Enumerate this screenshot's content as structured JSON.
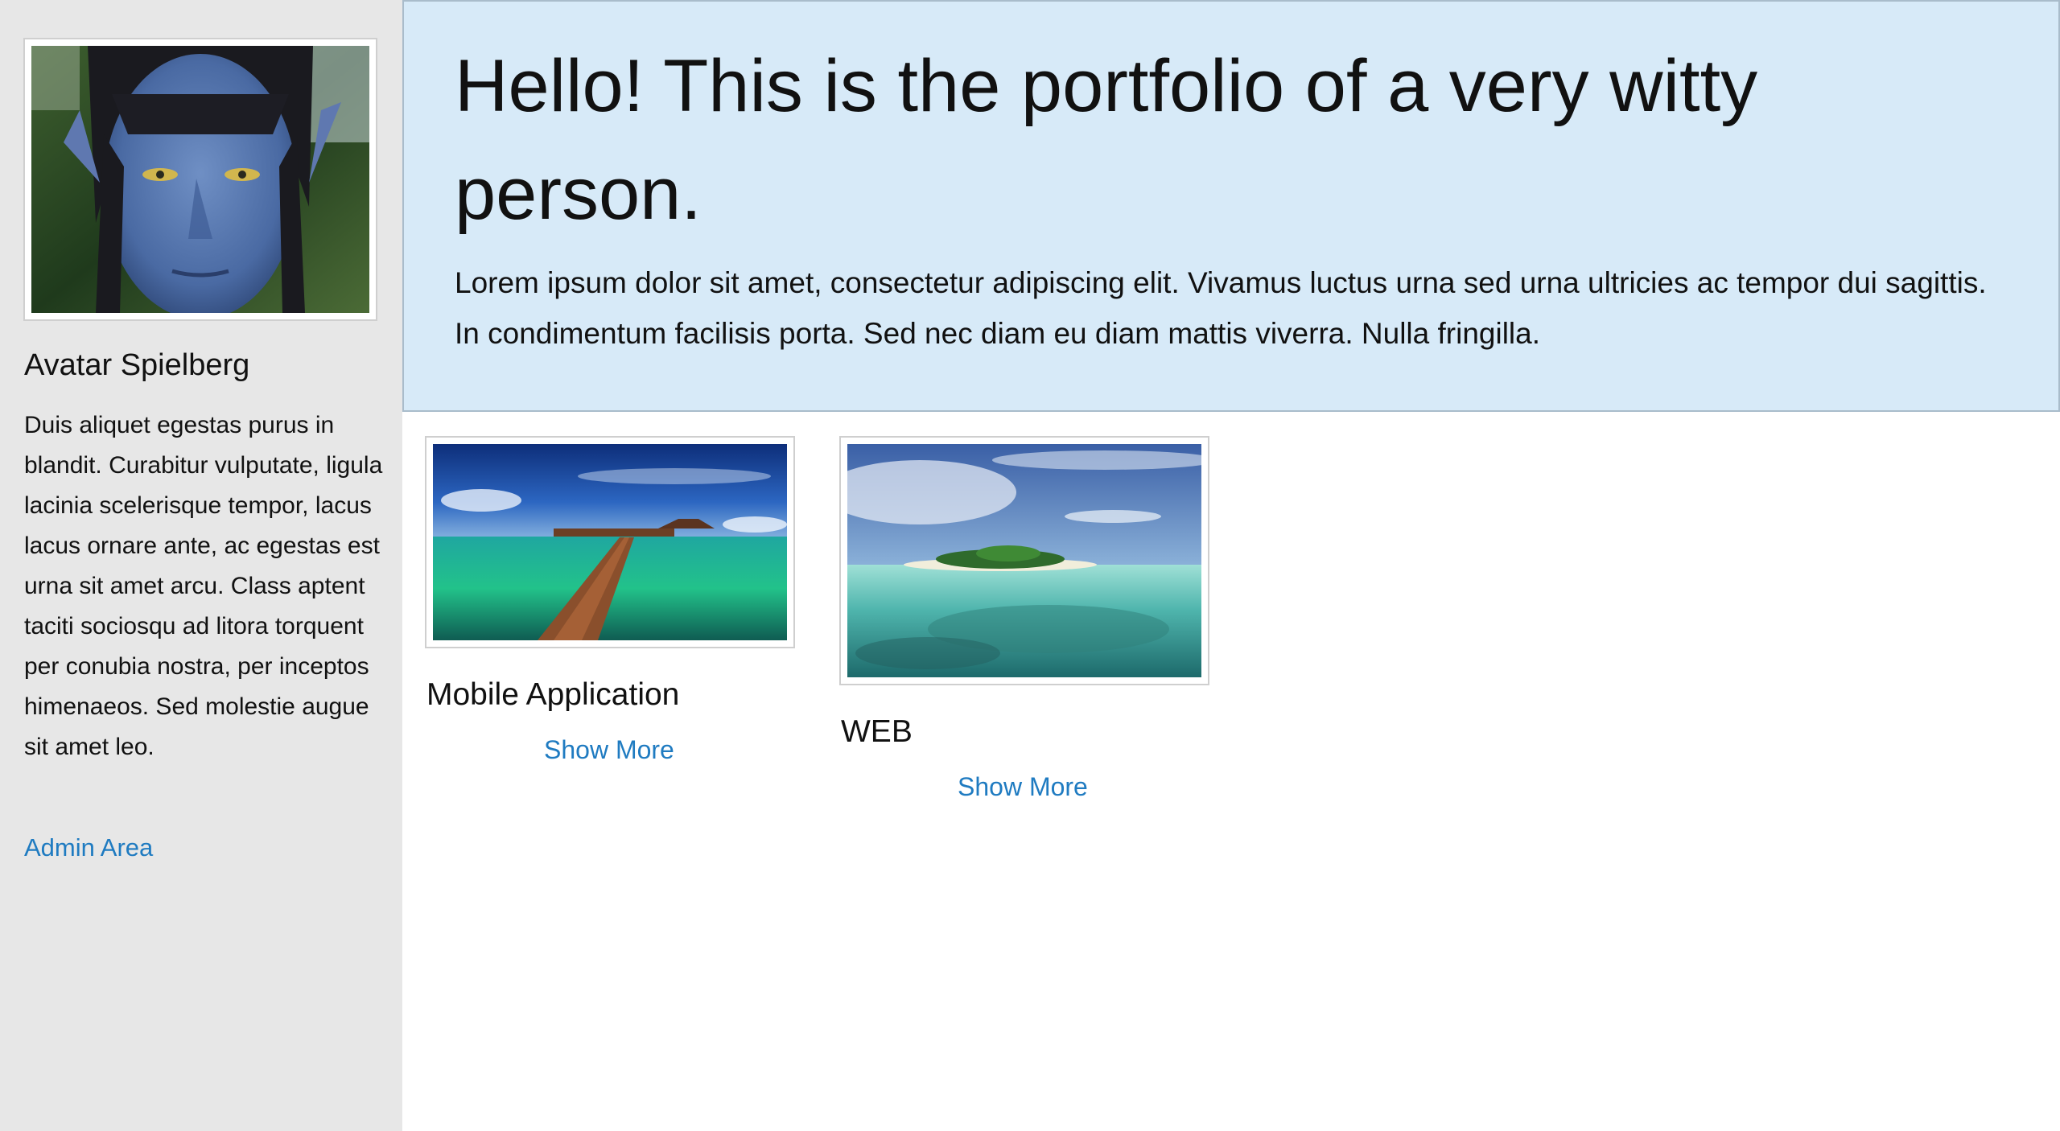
{
  "sidebar": {
    "avatar_alt": "Avatar portrait",
    "name": "Avatar Spielberg",
    "bio": "Duis aliquet egestas purus in blandit. Curabitur vulputate, ligula lacinia scelerisque tempor, lacus lacus ornare ante, ac egestas est urna sit amet arcu. Class aptent taciti sociosqu ad litora torquent per conubia nostra, per inceptos himenaeos. Sed molestie augue sit amet leo.",
    "admin_link": "Admin Area"
  },
  "hero": {
    "title": "Hello! This is the portfolio of a very witty person.",
    "text": "Lorem ipsum dolor sit amet, consectetur adipiscing elit. Vivamus luctus urna sed urna ultricies ac tempor dui sagittis. In condimentum facilisis porta. Sed nec diam eu diam mattis viverra. Nulla fringilla."
  },
  "projects": [
    {
      "title": "Mobile Application",
      "link": "Show More",
      "image": "pier-over-lagoon-image"
    },
    {
      "title": "WEB",
      "link": "Show More",
      "image": "tropical-island-image"
    }
  ],
  "colors": {
    "sidebar_bg": "#e7e7e7",
    "hero_bg": "#d7eaf8",
    "link": "#1f7bc1"
  }
}
